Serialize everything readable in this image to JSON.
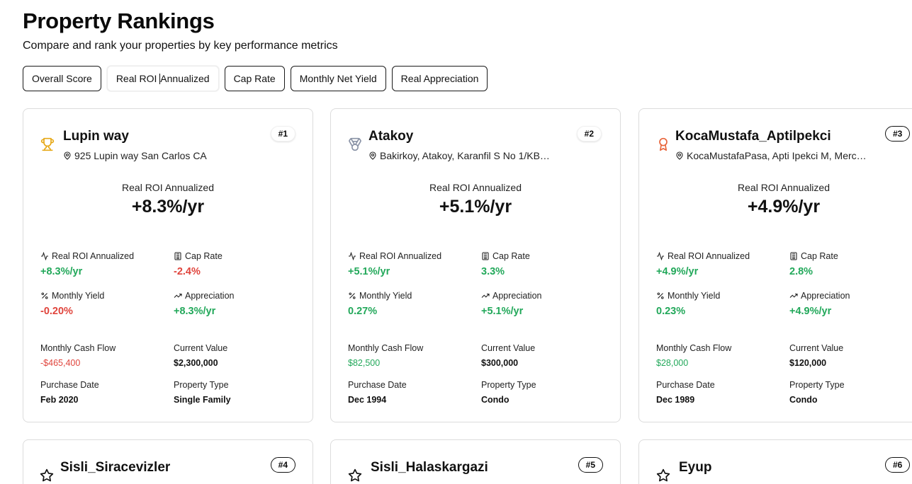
{
  "header": {
    "title": "Property Rankings",
    "subtitle": "Compare and rank your properties by key performance metrics"
  },
  "tabs": [
    {
      "label": "Overall Score"
    },
    {
      "label_before": "Real ROI",
      "label_after": "Annualized"
    },
    {
      "label": "Cap Rate"
    },
    {
      "label": "Monthly Net Yield"
    },
    {
      "label": "Real Appreciation"
    }
  ],
  "metric_labels": {
    "roi": "Real ROI Annualized",
    "cap": "Cap Rate",
    "yield": "Monthly Yield",
    "appreciation": "Appreciation",
    "cash_flow": "Monthly Cash Flow",
    "current_value": "Current Value",
    "purchase_date": "Purchase Date",
    "property_type": "Property Type"
  },
  "colors": {
    "positive": "#22a85a",
    "negative": "#e0443c",
    "gold": "#e6a817",
    "silver": "#8a93a6",
    "bronze": "#e8643a"
  },
  "cards": [
    {
      "rank": "#1",
      "icon": "trophy-icon",
      "name": "Lupin way",
      "address": "925 Lupin way San Carlos CA",
      "hero_label": "Real ROI Annualized",
      "hero_value": "+8.3%/yr",
      "roi": "+8.3%/yr",
      "cap": "-2.4%",
      "yield": "-0.20%",
      "appreciation": "+8.3%/yr",
      "cash_flow": "-$465,400",
      "current_value": "$2,300,000",
      "purchase_date": "Feb 2020",
      "property_type": "Single Family"
    },
    {
      "rank": "#2",
      "icon": "medal-icon",
      "name": "Atakoy",
      "address": "Bakirkoy, Atakoy, Karanfil S No 1/KB…",
      "hero_label": "Real ROI Annualized",
      "hero_value": "+5.1%/yr",
      "roi": "+5.1%/yr",
      "cap": "3.3%",
      "yield": "0.27%",
      "appreciation": "+5.1%/yr",
      "cash_flow": "$82,500",
      "current_value": "$300,000",
      "purchase_date": "Dec 1994",
      "property_type": "Condo"
    },
    {
      "rank": "#3",
      "icon": "award-icon",
      "name": "KocaMustafa_Aptilpekci",
      "address": "KocaMustafaPasa, Apti Ipekci M, Merc…",
      "hero_label": "Real ROI Annualized",
      "hero_value": "+4.9%/yr",
      "roi": "+4.9%/yr",
      "cap": "2.8%",
      "yield": "0.23%",
      "appreciation": "+4.9%/yr",
      "cash_flow": "$28,000",
      "current_value": "$120,000",
      "purchase_date": "Dec 1989",
      "property_type": "Condo"
    },
    {
      "rank": "#4",
      "icon": "star-icon",
      "name": "Sisli_Siracevizler"
    },
    {
      "rank": "#5",
      "icon": "star-icon",
      "name": "Sisli_Halaskargazi"
    },
    {
      "rank": "#6",
      "icon": "star-icon",
      "name": "Eyup"
    }
  ]
}
